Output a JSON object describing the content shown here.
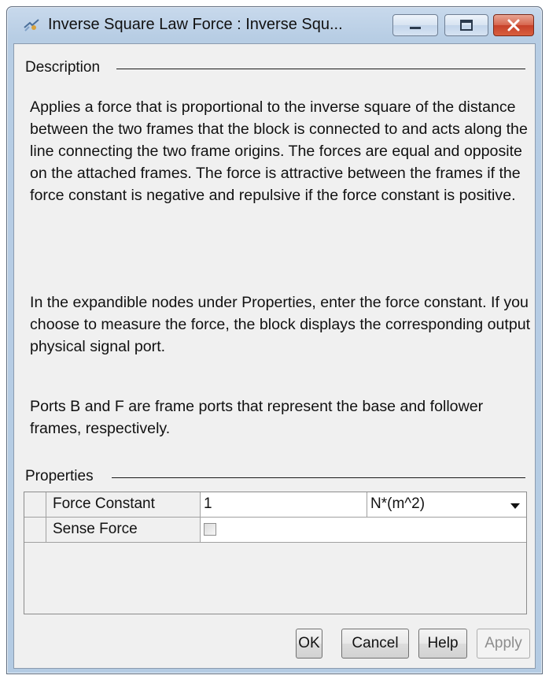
{
  "window": {
    "title": "Inverse Square Law Force : Inverse Squ...",
    "controls": {
      "minimize": "minimize-icon",
      "maximize": "maximize-icon",
      "close": "close-icon"
    },
    "app_icon": "block-parameters-icon"
  },
  "description": {
    "heading": "Description",
    "paragraphs": [
      "Applies a force that is proportional to the inverse square of the distance between the two frames that the block is connected to and acts along the line connecting the two frame origins. The forces are equal and opposite on the attached frames. The force is attractive between the frames if the force constant is negative and repulsive if the force constant is positive.",
      "In the expandible nodes under Properties, enter the force constant. If you choose to measure the force, the block displays the corresponding output physical signal port.",
      "Ports B and F are frame ports that represent the base and follower frames, respectively."
    ]
  },
  "properties": {
    "heading": "Properties",
    "rows": [
      {
        "name": "Force Constant",
        "value": "1",
        "unit": "N*(m^2)"
      },
      {
        "name": "Sense Force",
        "checked": false
      }
    ]
  },
  "buttons": {
    "ok": "OK",
    "cancel": "Cancel",
    "help": "Help",
    "apply": "Apply"
  },
  "colors": {
    "frame": "#b9cfe6",
    "close_button": "#c6412a",
    "dialog_bg": "#f0f0f0"
  }
}
